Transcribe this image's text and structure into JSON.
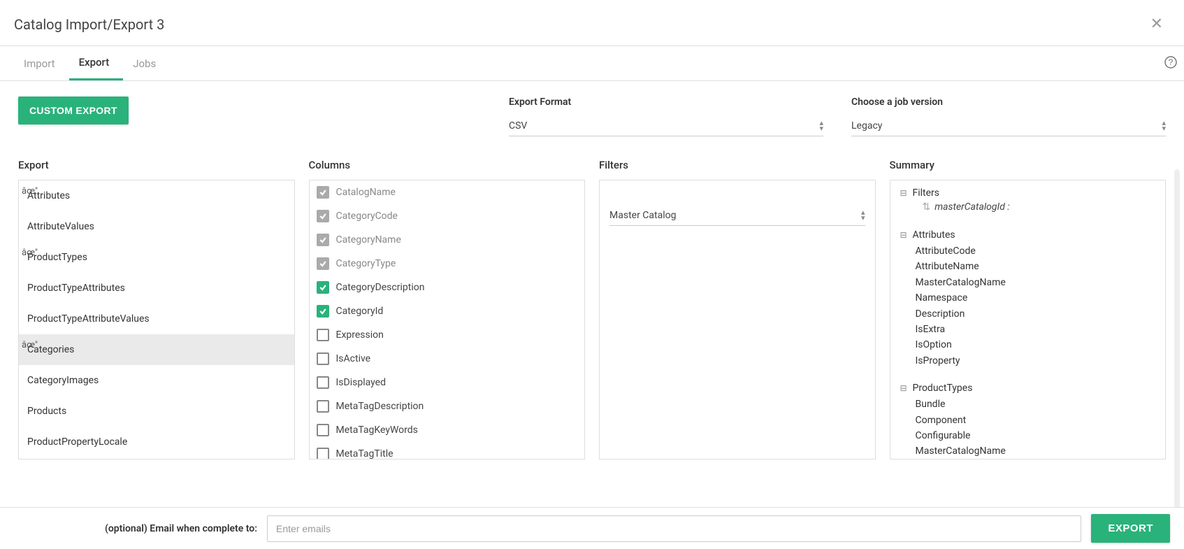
{
  "header": {
    "title": "Catalog Import/Export 3"
  },
  "tabs": {
    "import": "Import",
    "export": "Export",
    "jobs": "Jobs"
  },
  "buttons": {
    "custom_export": "CUSTOM EXPORT",
    "export": "EXPORT"
  },
  "fields": {
    "export_format": {
      "label": "Export Format",
      "value": "CSV"
    },
    "job_version": {
      "label": "Choose a job version",
      "value": "Legacy"
    }
  },
  "panels": {
    "export": {
      "title": "Export"
    },
    "columns": {
      "title": "Columns"
    },
    "filters": {
      "title": "Filters"
    },
    "summary": {
      "title": "Summary"
    }
  },
  "export_items": [
    {
      "label": "Attributes",
      "checked": true
    },
    {
      "label": "AttributeValues",
      "checked": false
    },
    {
      "label": "ProductTypes",
      "checked": true
    },
    {
      "label": "ProductTypeAttributes",
      "checked": false
    },
    {
      "label": "ProductTypeAttributeValues",
      "checked": false
    },
    {
      "label": "Categories",
      "checked": true,
      "selected": true
    },
    {
      "label": "CategoryImages",
      "checked": false
    },
    {
      "label": "Products",
      "checked": false
    },
    {
      "label": "ProductPropertyLocale",
      "checked": false
    }
  ],
  "column_items": [
    {
      "label": "CatalogName",
      "state": "locked"
    },
    {
      "label": "CategoryCode",
      "state": "locked"
    },
    {
      "label": "CategoryName",
      "state": "locked"
    },
    {
      "label": "CategoryType",
      "state": "locked"
    },
    {
      "label": "CategoryDescription",
      "state": "checked"
    },
    {
      "label": "CategoryId",
      "state": "checked"
    },
    {
      "label": "Expression",
      "state": "unchecked"
    },
    {
      "label": "IsActive",
      "state": "unchecked"
    },
    {
      "label": "IsDisplayed",
      "state": "unchecked"
    },
    {
      "label": "MetaTagDescription",
      "state": "unchecked"
    },
    {
      "label": "MetaTagKeyWords",
      "state": "unchecked"
    },
    {
      "label": "MetaTagTitle",
      "state": "unchecked"
    }
  ],
  "filters": {
    "master_catalog": "Master Catalog"
  },
  "summary": {
    "filters": {
      "title": "Filters",
      "sub": "masterCatalogId :"
    },
    "attributes": {
      "title": "Attributes",
      "items": [
        "AttributeCode",
        "AttributeName",
        "MasterCatalogName",
        "Namespace",
        "Description",
        "IsExtra",
        "IsOption",
        "IsProperty"
      ]
    },
    "producttypes": {
      "title": "ProductTypes",
      "items": [
        "Bundle",
        "Component",
        "Configurable",
        "MasterCatalogName"
      ]
    }
  },
  "footer": {
    "email_label": "(optional) Email when complete to:",
    "email_placeholder": "Enter emails"
  }
}
